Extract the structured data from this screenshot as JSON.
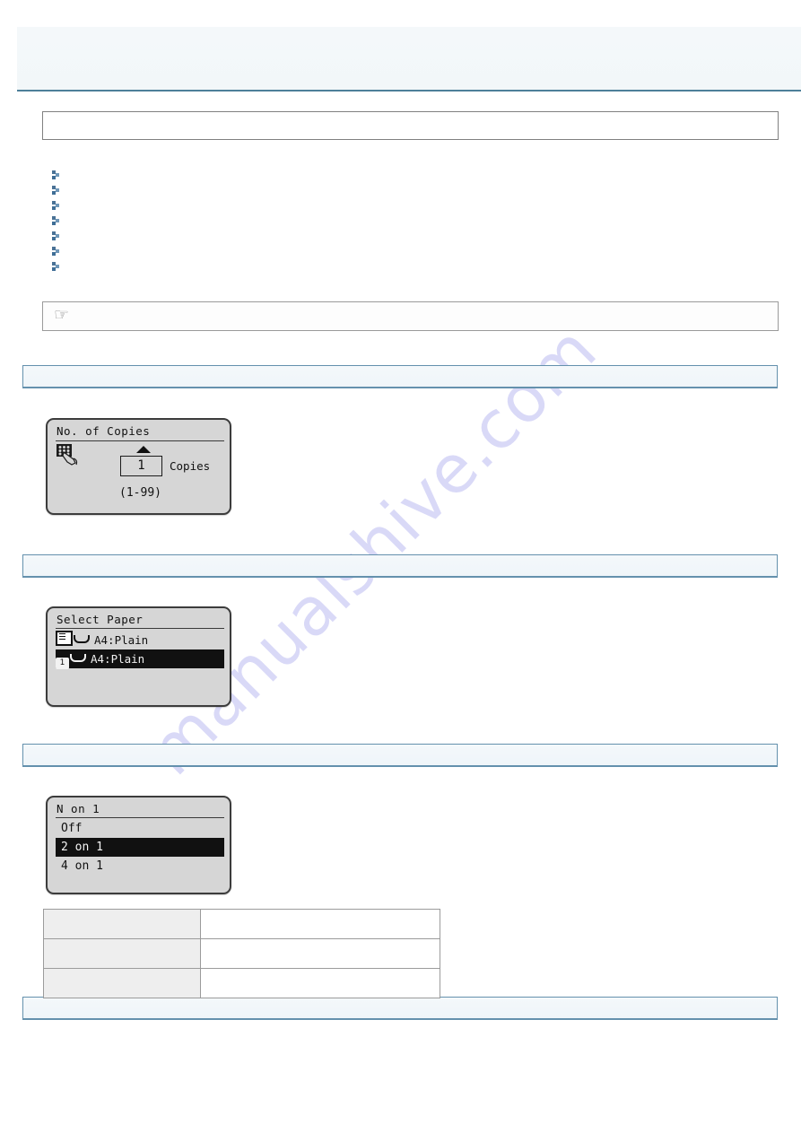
{
  "document": {
    "watermark": "manualshive.com"
  },
  "header": {
    "title": "",
    "subtitle": ""
  },
  "intro_box": {
    "text": ""
  },
  "link_list": {
    "bullet_icon": "chevron-right-icon",
    "items": [
      {
        "label": ""
      },
      {
        "label": ""
      },
      {
        "label": ""
      },
      {
        "label": ""
      },
      {
        "label": ""
      },
      {
        "label": ""
      },
      {
        "label": ""
      }
    ]
  },
  "note_box": {
    "icon": "pointing-hand-icon",
    "glyph": "☞",
    "text": ""
  },
  "sections": [
    {
      "label": ""
    },
    {
      "label": ""
    },
    {
      "label": ""
    },
    {
      "label": ""
    }
  ],
  "lcd_copies": {
    "title": "No. of Copies",
    "keypad_icon": "numeric-keypad-hand-icon",
    "up_arrow_icon": "arrow-up-icon",
    "value": "1",
    "unit": "Copies",
    "range": "(1-99)"
  },
  "lcd_select_paper": {
    "title": "Select Paper",
    "rows": [
      {
        "source_icon": "multi-purpose-tray-icon",
        "source_label": "",
        "label": "A4:Plain",
        "selected": false
      },
      {
        "source_icon": "paper-cassette-1-icon",
        "source_label": "1",
        "label": "A4:Plain",
        "selected": true
      }
    ]
  },
  "lcd_n_on_1": {
    "title": "N on 1",
    "rows": [
      {
        "label": "Off",
        "selected": false
      },
      {
        "label": "2 on 1",
        "selected": true
      },
      {
        "label": "4 on 1",
        "selected": false
      }
    ]
  },
  "options_table": {
    "rows": [
      {
        "key": "",
        "value": ""
      },
      {
        "key": "",
        "value": ""
      },
      {
        "key": "",
        "value": ""
      }
    ]
  },
  "colors": {
    "accent_border": "#6491ad",
    "section_fill": "#f2f7f9",
    "header_rule": "#4d7f99",
    "bullet_blue": "#3f6e96",
    "lcd_screen": "#d6d6d6",
    "lcd_bezel": "#3c3c3c",
    "watermark": "#d9d9f7"
  }
}
